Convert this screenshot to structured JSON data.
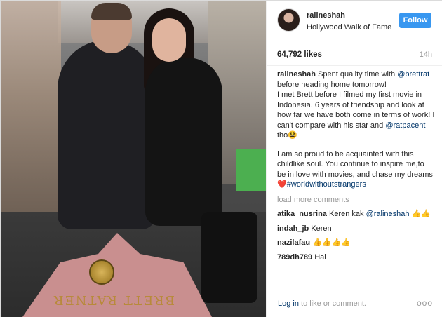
{
  "post": {
    "username": "ralineshah",
    "location": "Hollywood Walk of Fame",
    "follow_label": "Follow",
    "likes": "64,792 likes",
    "time_ago": "14h",
    "star_name": "BRETT RATNER",
    "caption": {
      "username": "ralineshah",
      "line1_a": " Spent quality time with ",
      "mention1": "@brettrat",
      "line1_b": " before heading home tomorrow!",
      "para2": "I met Brett before I filmed my first movie in Indonesia. 6 years of friendship and look at how far we have both come in terms of work! I can't compare with his star and ",
      "mention2": "@ratpacent",
      "para2_end": " tho😫",
      "para3": "I am so proud to be acquainted with this childlike soul. You continue to inspire me,to be in love with movies, and chase my dreams",
      "heart": "❤️",
      "hashtag": "#worldwithoutstrangers"
    },
    "load_more": "load more comments",
    "comments": [
      {
        "user": "atika_nusrina",
        "text_a": " Keren kak ",
        "mention": "@ralineshah",
        "text_b": " 👍👍"
      },
      {
        "user": "indah_jb",
        "text_a": " Keren",
        "mention": "",
        "text_b": ""
      },
      {
        "user": "nazilafau",
        "text_a": " 👍👍👍👍",
        "mention": "",
        "text_b": ""
      },
      {
        "user": "789dh789",
        "text_a": " Hai",
        "mention": "",
        "text_b": ""
      }
    ],
    "footer": {
      "login_link": "Log in",
      "login_rest": " to like or comment.",
      "more_icon": "more-dots-icon",
      "more_glyph": "ooo"
    }
  },
  "colors": {
    "follow_blue": "#3897f0",
    "link_navy": "#003569",
    "muted_gray": "#999999",
    "heart_red": "#ed4956"
  }
}
